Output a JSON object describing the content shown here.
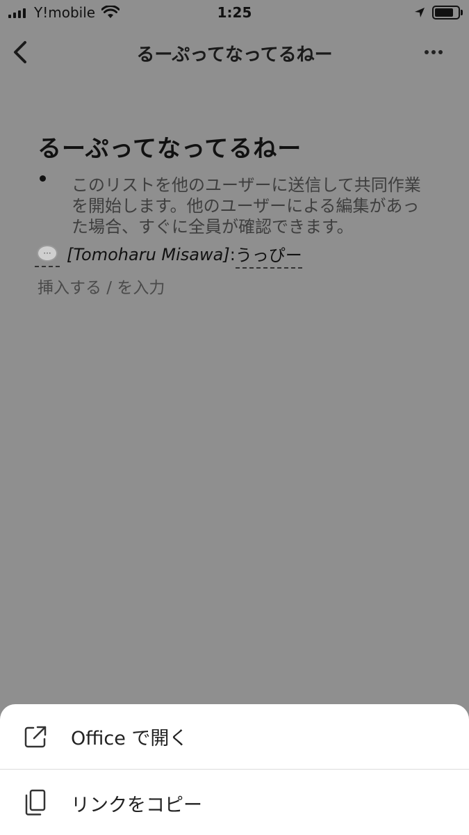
{
  "status_bar": {
    "carrier": "Y!mobile",
    "time": "1:25",
    "signal_bars": 4,
    "battery_level": 0.8
  },
  "nav": {
    "title": "るーぷってなってるねー",
    "back_icon": "chevron-left-icon",
    "more_icon": "more-horizontal-icon"
  },
  "document": {
    "title": "るーぷってなってるねー",
    "bullet_text": "このリストを他のユーザーに送信して共同作業を開始します。他のユーザーによる編集があった場合、すぐに全員が確認できます。",
    "comment": {
      "icon": "speech-bubble-icon",
      "author": "[Tomoharu Misawa]",
      "separator": ":",
      "text": "うっぴー"
    },
    "insert_hint": "挿入する / を入力"
  },
  "action_sheet": {
    "items": [
      {
        "label": "Office で開く",
        "icon": "open-external-icon"
      },
      {
        "label": "リンクをコピー",
        "icon": "copy-icon"
      }
    ]
  },
  "colors": {
    "overlay_background": "#8f8f8f",
    "sheet_background": "#ffffff"
  }
}
